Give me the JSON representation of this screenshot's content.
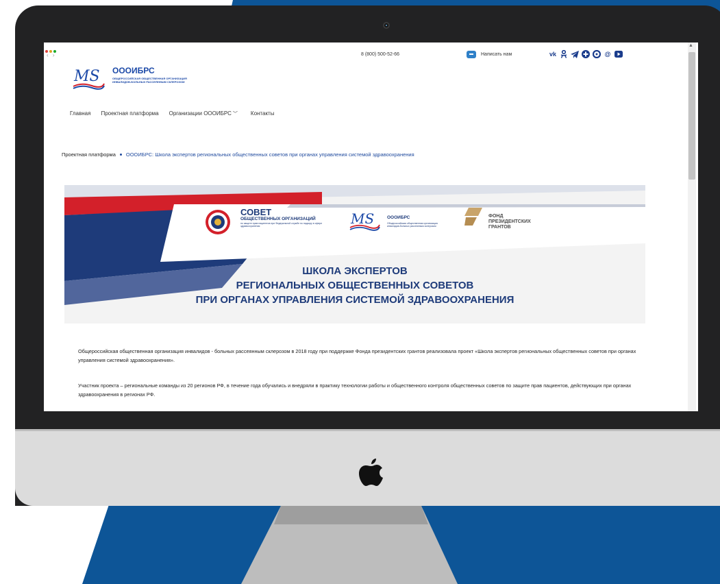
{
  "colors": {
    "background_blue": "#0d5597",
    "brand_blue": "#1d4aa8",
    "banner_red": "#d3202a",
    "banner_navy": "#1e3b7a",
    "monitor_bezel": "#222223",
    "monitor_chin": "#dcdcdc"
  },
  "header": {
    "logo_title": "ОООИБРС",
    "logo_subtitle": "ОБЩЕРОССИЙСКАЯ ОБЩЕСТВЕННАЯ ОРГАНИЗАЦИЯ ИНВАЛИДОВ-БОЛЬНЫХ РАССЕЯННЫМ СКЛЕРОЗОМ",
    "phone": "8 (800) 500-52-66",
    "write_us": "Написать нам",
    "socials": [
      "vk-icon",
      "odnoklassniki-icon",
      "telegram-icon",
      "plus-icon",
      "viber-icon",
      "mail-icon",
      "youtube-icon"
    ]
  },
  "menu": {
    "items": [
      "Главная",
      "Проектная платформа",
      "Организации ОООИБРС",
      "Контакты"
    ]
  },
  "breadcrumb": {
    "parent": "Проектная платформа",
    "current": "ОООИБРС: Школа экспертов региональных общественных советов при органах управления системой здравоохранения"
  },
  "banner": {
    "sovet_big": "СОВЕТ",
    "sovet_mid": "ОБЩЕСТВЕННЫХ ОРГАНИЗАЦИЙ",
    "sovet_small": "по защите прав пациентов при Федеральной службе по надзору в сфере здравоохранения",
    "ms_title": "ОООИБРС",
    "ms_sub": "Общероссийская общественная организация инвалидов-больных рассеянным склерозом",
    "fond_line1": "ФОНД",
    "fond_line2": "ПРЕЗИДЕНТСКИХ",
    "fond_line3": "ГРАНТОВ",
    "title_line1": "ШКОЛА ЭКСПЕРТОВ",
    "title_line2": "РЕГИОНАЛЬНЫХ ОБЩЕСТВЕННЫХ СОВЕТОВ",
    "title_line3": "ПРИ ОРГАНАХ УПРАВЛЕНИЯ СИСТЕМОЙ ЗДРАВООХРАНЕНИЯ"
  },
  "content": {
    "p1": "Общероссийская общественная организация инвалидов - больных рассеянным склерозом в 2018 году при поддержке Фонда президентских грантов реализовала проект «Школа экспертов региональных общественных советов при органах управления системой здравоохранения».",
    "p2": "Участник проекта – региональные команды из 20 регионов РФ, в течение года обучались и внедряли в практику технологии работы и общественного контроля общественных советов по защите прав пациентов, действующих при органах здравоохранения в регионах РФ."
  }
}
